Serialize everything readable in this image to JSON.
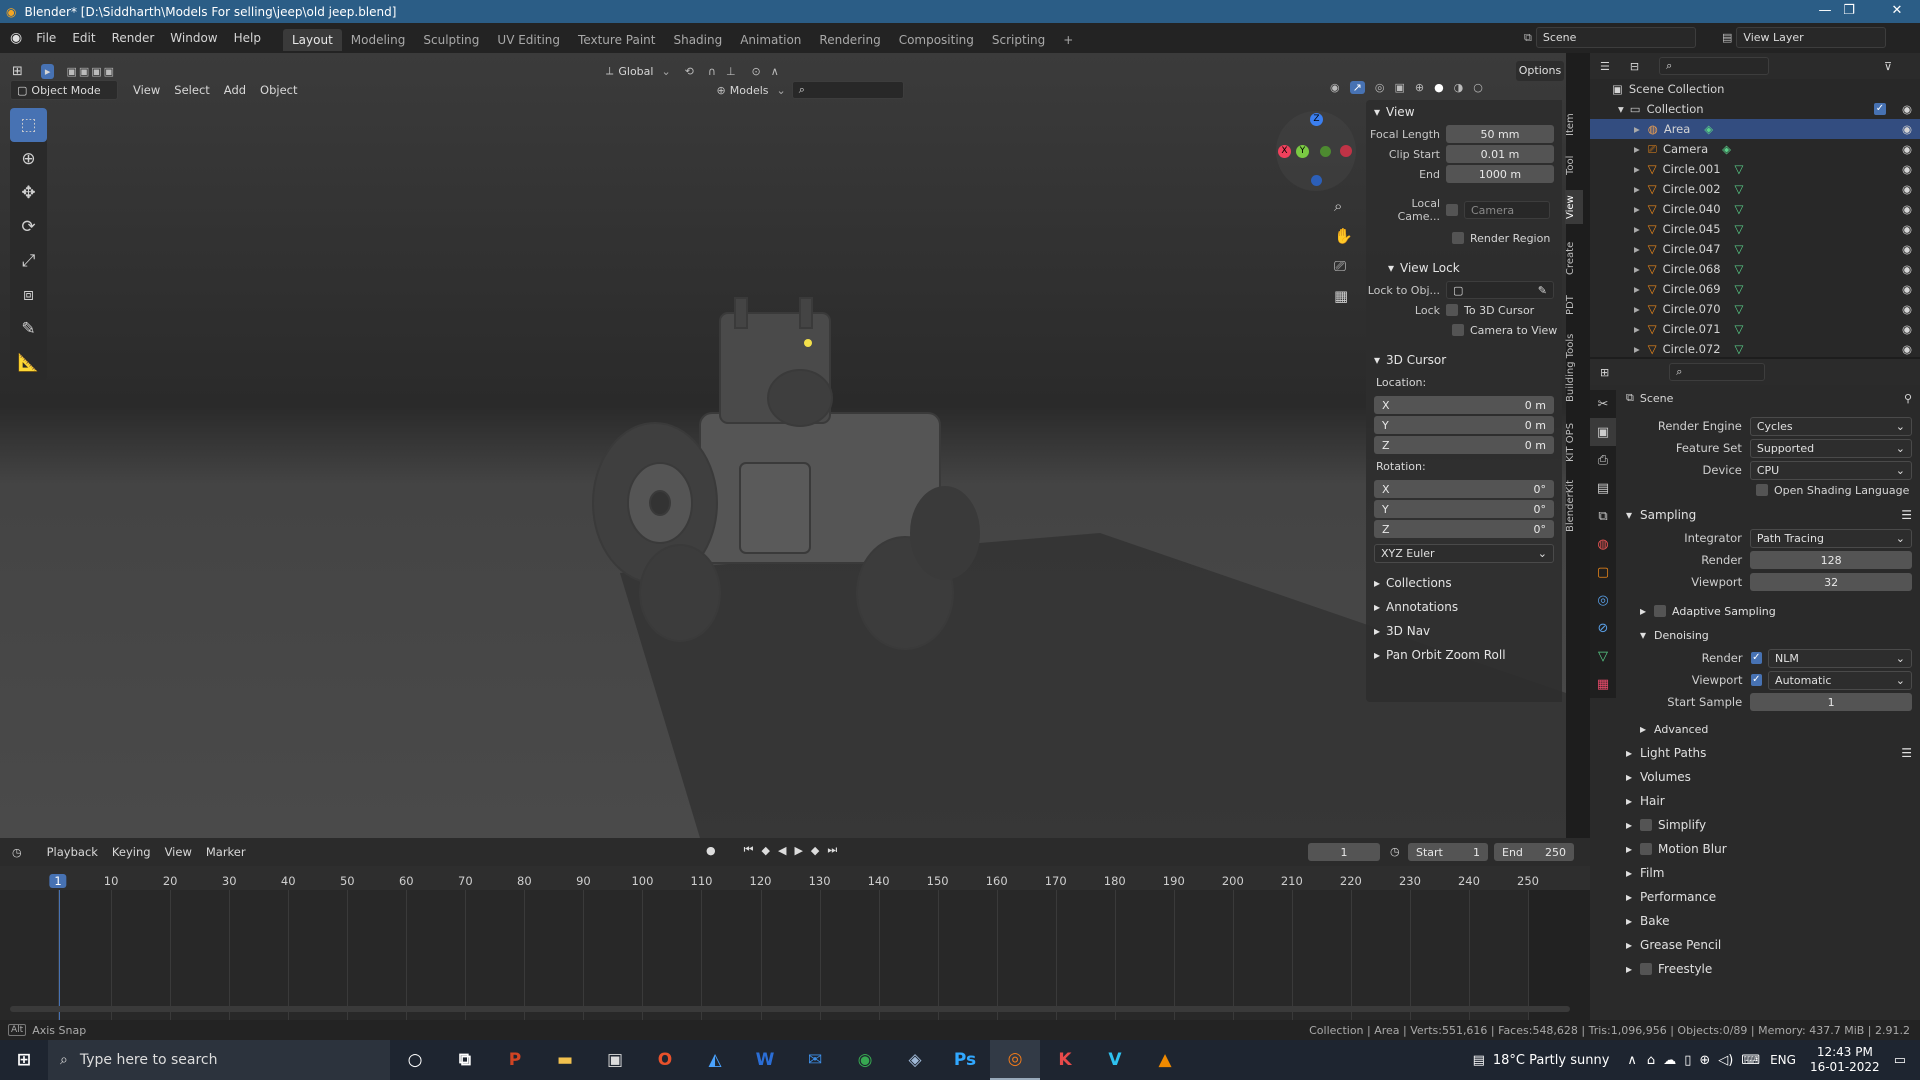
{
  "window": {
    "title": "Blender* [D:\\Siddharth\\Models For selling\\jeep\\old jeep.blend]",
    "minimize": "—",
    "restore": "❐",
    "close": "✕"
  },
  "menu": [
    "File",
    "Edit",
    "Render",
    "Window",
    "Help"
  ],
  "workspaces": [
    "Layout",
    "Modeling",
    "Sculpting",
    "UV Editing",
    "Texture Paint",
    "Shading",
    "Animation",
    "Rendering",
    "Compositing",
    "Scripting"
  ],
  "workspace_add": "+",
  "scene": {
    "label": "Scene",
    "view_layer": "View Layer"
  },
  "viewport_header": {
    "orientation": "Global",
    "options": "Options",
    "mode": "Object Mode",
    "menus": [
      "View",
      "Select",
      "Add",
      "Object"
    ],
    "collection_filter": "Models"
  },
  "npanel": {
    "tabs": [
      "Item",
      "Tool",
      "View",
      "Create",
      "PDT",
      "Building Tools",
      "KIT OPS",
      "BlenderKit"
    ],
    "view_section": "View",
    "focal_length_label": "Focal Length",
    "focal_length": "50 mm",
    "clip_start_label": "Clip Start",
    "clip_start": "0.01 m",
    "clip_end_label": "End",
    "clip_end": "1000 m",
    "local_camera_label": "Local Came...",
    "local_camera_value": "Camera",
    "render_region_label": "Render Region",
    "view_lock_section": "View Lock",
    "lock_to_obj_label": "Lock to Obj...",
    "lock_label": "Lock",
    "to_3d_cursor": "To 3D Cursor",
    "camera_to_view": "Camera to View",
    "cursor_section": "3D Cursor",
    "location_label": "Location:",
    "rotation_label": "Rotation:",
    "loc": [
      {
        "axis": "X",
        "value": "0 m"
      },
      {
        "axis": "Y",
        "value": "0 m"
      },
      {
        "axis": "Z",
        "value": "0 m"
      }
    ],
    "rot": [
      {
        "axis": "X",
        "value": "0°"
      },
      {
        "axis": "Y",
        "value": "0°"
      },
      {
        "axis": "Z",
        "value": "0°"
      }
    ],
    "rotation_mode": "XYZ Euler",
    "collapsed": [
      "Collections",
      "Annotations",
      "3D Nav",
      "Pan Orbit Zoom Roll"
    ]
  },
  "outliner": {
    "scene_collection": "Scene Collection",
    "collection": "Collection",
    "items": [
      "Area",
      "Camera",
      "Circle.001",
      "Circle.002",
      "Circle.040",
      "Circle.045",
      "Circle.047",
      "Circle.068",
      "Circle.069",
      "Circle.070",
      "Circle.071",
      "Circle.072"
    ]
  },
  "properties": {
    "context": "Scene",
    "render_engine_label": "Render Engine",
    "render_engine": "Cycles",
    "feature_set_label": "Feature Set",
    "feature_set": "Supported",
    "device_label": "Device",
    "device": "CPU",
    "osl_label": "Open Shading Language",
    "sampling": "Sampling",
    "integrator_label": "Integrator",
    "integrator": "Path Tracing",
    "render_label": "Render",
    "render_samples": "128",
    "viewport_label": "Viewport",
    "viewport_samples": "32",
    "adaptive_sampling": "Adaptive Sampling",
    "denoising": "Denoising",
    "denoise_render_label": "Render",
    "denoise_render": "NLM",
    "denoise_viewport_label": "Viewport",
    "denoise_viewport": "Automatic",
    "start_sample_label": "Start Sample",
    "start_sample": "1",
    "advanced": "Advanced",
    "sections": [
      "Light Paths",
      "Volumes",
      "Hair",
      "Simplify",
      "Motion Blur",
      "Film",
      "Performance",
      "Bake",
      "Grease Pencil",
      "Freestyle"
    ]
  },
  "timeline": {
    "menus": [
      "Playback",
      "Keying",
      "View",
      "Marker"
    ],
    "current_frame": "1",
    "start_label": "Start",
    "start": "1",
    "end_label": "End",
    "end": "250",
    "ticks": [
      "1",
      "10",
      "20",
      "30",
      "40",
      "50",
      "60",
      "70",
      "80",
      "90",
      "100",
      "110",
      "120",
      "130",
      "140",
      "150",
      "160",
      "170",
      "180",
      "190",
      "200",
      "210",
      "220",
      "230",
      "240",
      "250"
    ]
  },
  "status": {
    "left": "Axis Snap",
    "right": "Collection | Area | Verts:551,616 | Faces:548,628 | Tris:1,096,956 | Objects:0/89 | Memory: 437.7 MiB | 2.91.2"
  },
  "taskbar": {
    "search_placeholder": "Type here to search",
    "weather": "18°C  Partly sunny",
    "lang": "ENG",
    "time": "12:43 PM",
    "date": "16-01-2022",
    "apps": [
      {
        "name": "powerpoint",
        "glyph": "P",
        "color": "#d04423"
      },
      {
        "name": "file-explorer",
        "glyph": "▬",
        "color": "#f2c14e"
      },
      {
        "name": "store",
        "glyph": "▣",
        "color": "#dcdcdc"
      },
      {
        "name": "office",
        "glyph": "O",
        "color": "#e8512b"
      },
      {
        "name": "photos",
        "glyph": "◭",
        "color": "#4aa3ff"
      },
      {
        "name": "word",
        "glyph": "W",
        "color": "#2b6ed6"
      },
      {
        "name": "mail",
        "glyph": "✉",
        "color": "#3d8ee6"
      },
      {
        "name": "chrome",
        "glyph": "◉",
        "color": "#37a851"
      },
      {
        "name": "app",
        "glyph": "◈",
        "color": "#9fb8d6"
      },
      {
        "name": "photoshop",
        "glyph": "Ps",
        "color": "#31a8ff"
      },
      {
        "name": "blender",
        "glyph": "◎",
        "color": "#f07a1a"
      },
      {
        "name": "keyshot",
        "glyph": "K",
        "color": "#e84a4a"
      },
      {
        "name": "vray",
        "glyph": "V",
        "color": "#2ec2f0"
      },
      {
        "name": "vlc",
        "glyph": "▲",
        "color": "#f08a00"
      }
    ]
  }
}
